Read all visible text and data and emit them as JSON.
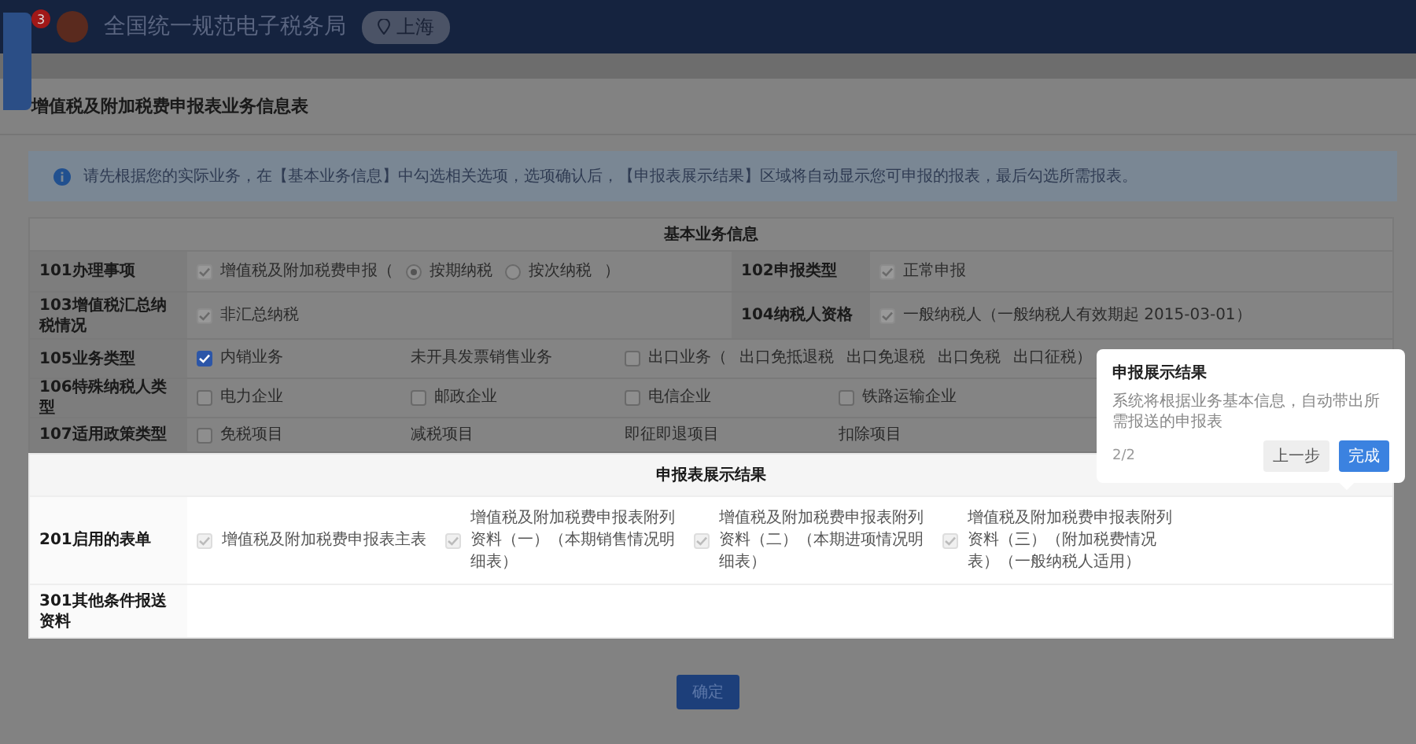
{
  "header": {
    "badge": "3",
    "title": "全国统一规范电子税务局",
    "location": "上海"
  },
  "page_title": "增值税及附加税费申报表业务信息表",
  "notice": "请先根据您的实际业务，在【基本业务信息】中勾选相关选项，选项确认后，【申报表展示结果】区域将自动显示您可申报的报表，最后勾选所需报表。",
  "basic_info": {
    "title": "基本业务信息",
    "pair_rows": [
      {
        "cells": [
          {
            "label": "101办理事项",
            "options": [
              {
                "kind": "checkbox",
                "label": "增值税及附加税费申报（",
                "checked": true,
                "disabled": true
              },
              {
                "kind": "radio",
                "label": "按期纳税",
                "selected": true
              },
              {
                "kind": "radio",
                "label": "按次纳税",
                "selected": false
              },
              {
                "kind": "sub",
                "label": "）"
              }
            ]
          },
          {
            "label": "102申报类型",
            "options": [
              {
                "kind": "checkbox",
                "label": "正常申报",
                "checked": true,
                "disabled": true
              }
            ]
          }
        ]
      },
      {
        "cells": [
          {
            "label": "103增值税汇总纳税情况",
            "options": [
              {
                "kind": "checkbox",
                "label": "非汇总纳税",
                "checked": true,
                "disabled": true
              }
            ]
          },
          {
            "label": "104纳税人资格",
            "options": [
              {
                "kind": "checkbox",
                "label": "一般纳税人（一般纳税人有效期起 2015-03-01）",
                "checked": true,
                "disabled": true
              }
            ]
          }
        ]
      }
    ],
    "full_rows": [
      {
        "label": "105业务类型",
        "options": [
          {
            "kind": "checkbox",
            "label": "内销业务",
            "checked": true,
            "disabled": false
          },
          {
            "kind": "text",
            "label": "未开具发票销售业务"
          },
          {
            "kind": "checkbox",
            "label": "出口业务（",
            "checked": false
          },
          {
            "kind": "sub",
            "label": "出口免抵退税"
          },
          {
            "kind": "sub",
            "label": "出口免退税"
          },
          {
            "kind": "sub",
            "label": "出口免税"
          },
          {
            "kind": "sub",
            "label": "出口征税）"
          }
        ]
      },
      {
        "label": "106特殊纳税人类型",
        "options": [
          {
            "kind": "checkbox",
            "label": "电力企业",
            "checked": false
          },
          {
            "kind": "checkbox",
            "label": "邮政企业",
            "checked": false
          },
          {
            "kind": "checkbox",
            "label": "电信企业",
            "checked": false
          },
          {
            "kind": "checkbox",
            "label": "铁路运输企业",
            "checked": false
          }
        ]
      },
      {
        "label": "107适用政策类型",
        "options": [
          {
            "kind": "checkbox",
            "label": "免税项目",
            "checked": false
          },
          {
            "kind": "text",
            "label": "减税项目"
          },
          {
            "kind": "text",
            "label": "即征即退项目"
          },
          {
            "kind": "text",
            "label": "扣除项目"
          }
        ]
      }
    ]
  },
  "result": {
    "title": "申报表展示结果",
    "rows": [
      {
        "label": "201启用的表单",
        "options": [
          {
            "label": "增值税及附加税费申报表主表",
            "checked": true,
            "disabled": true
          },
          {
            "label": "增值税及附加税费申报表附列资料（一）（本期销售情况明细表）",
            "checked": true,
            "disabled": true
          },
          {
            "label": "增值税及附加税费申报表附列资料（二）（本期进项情况明细表）",
            "checked": true,
            "disabled": true
          },
          {
            "label": "增值税及附加税费申报表附列资料（三）（附加税费情况表）（一般纳税人适用）",
            "checked": true,
            "disabled": true
          }
        ]
      },
      {
        "label": "301其他条件报送资料",
        "options": []
      }
    ]
  },
  "confirm_button": "确定",
  "popover": {
    "title": "申报展示结果",
    "description": "系统将根据业务基本信息，自动带出所需报送的申报表",
    "step": "2/2",
    "buttons": [
      {
        "label": "上一步",
        "primary": false
      },
      {
        "label": "完成",
        "primary": true
      }
    ]
  }
}
